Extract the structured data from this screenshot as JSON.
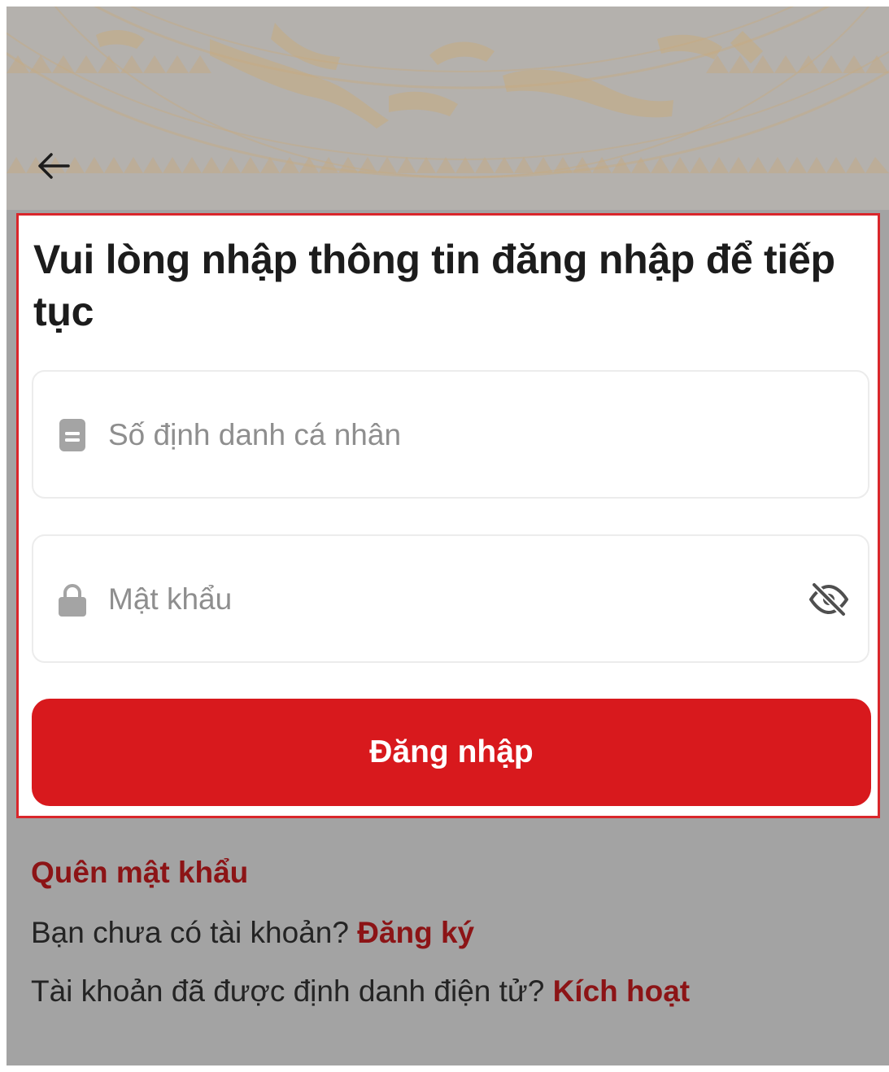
{
  "header": {
    "back_icon": "arrow-left-icon",
    "background_pattern": "bronze-drum-pattern"
  },
  "form": {
    "heading": "Vui lòng nhập thông tin đăng nhập để tiếp tục",
    "id_field": {
      "icon": "id-card-icon",
      "placeholder": "Số định danh cá nhân",
      "value": ""
    },
    "password_field": {
      "icon": "lock-icon",
      "placeholder": "Mật khẩu",
      "value": "",
      "toggle_icon": "eye-off-icon"
    },
    "login_label": "Đăng nhập",
    "highlight_color": "#d9262b"
  },
  "links": {
    "forgot_password": "Quên mật khẩu",
    "register_prompt": "Bạn chưa có tài khoản?",
    "register_link": "Đăng ký",
    "activate_prompt": "Tài khoản đã được định danh điện tử?",
    "activate_link": "Kích hoạt"
  },
  "colors": {
    "primary": "#d8191d",
    "link": "#8c1416",
    "overlay": "#a3a3a3"
  }
}
